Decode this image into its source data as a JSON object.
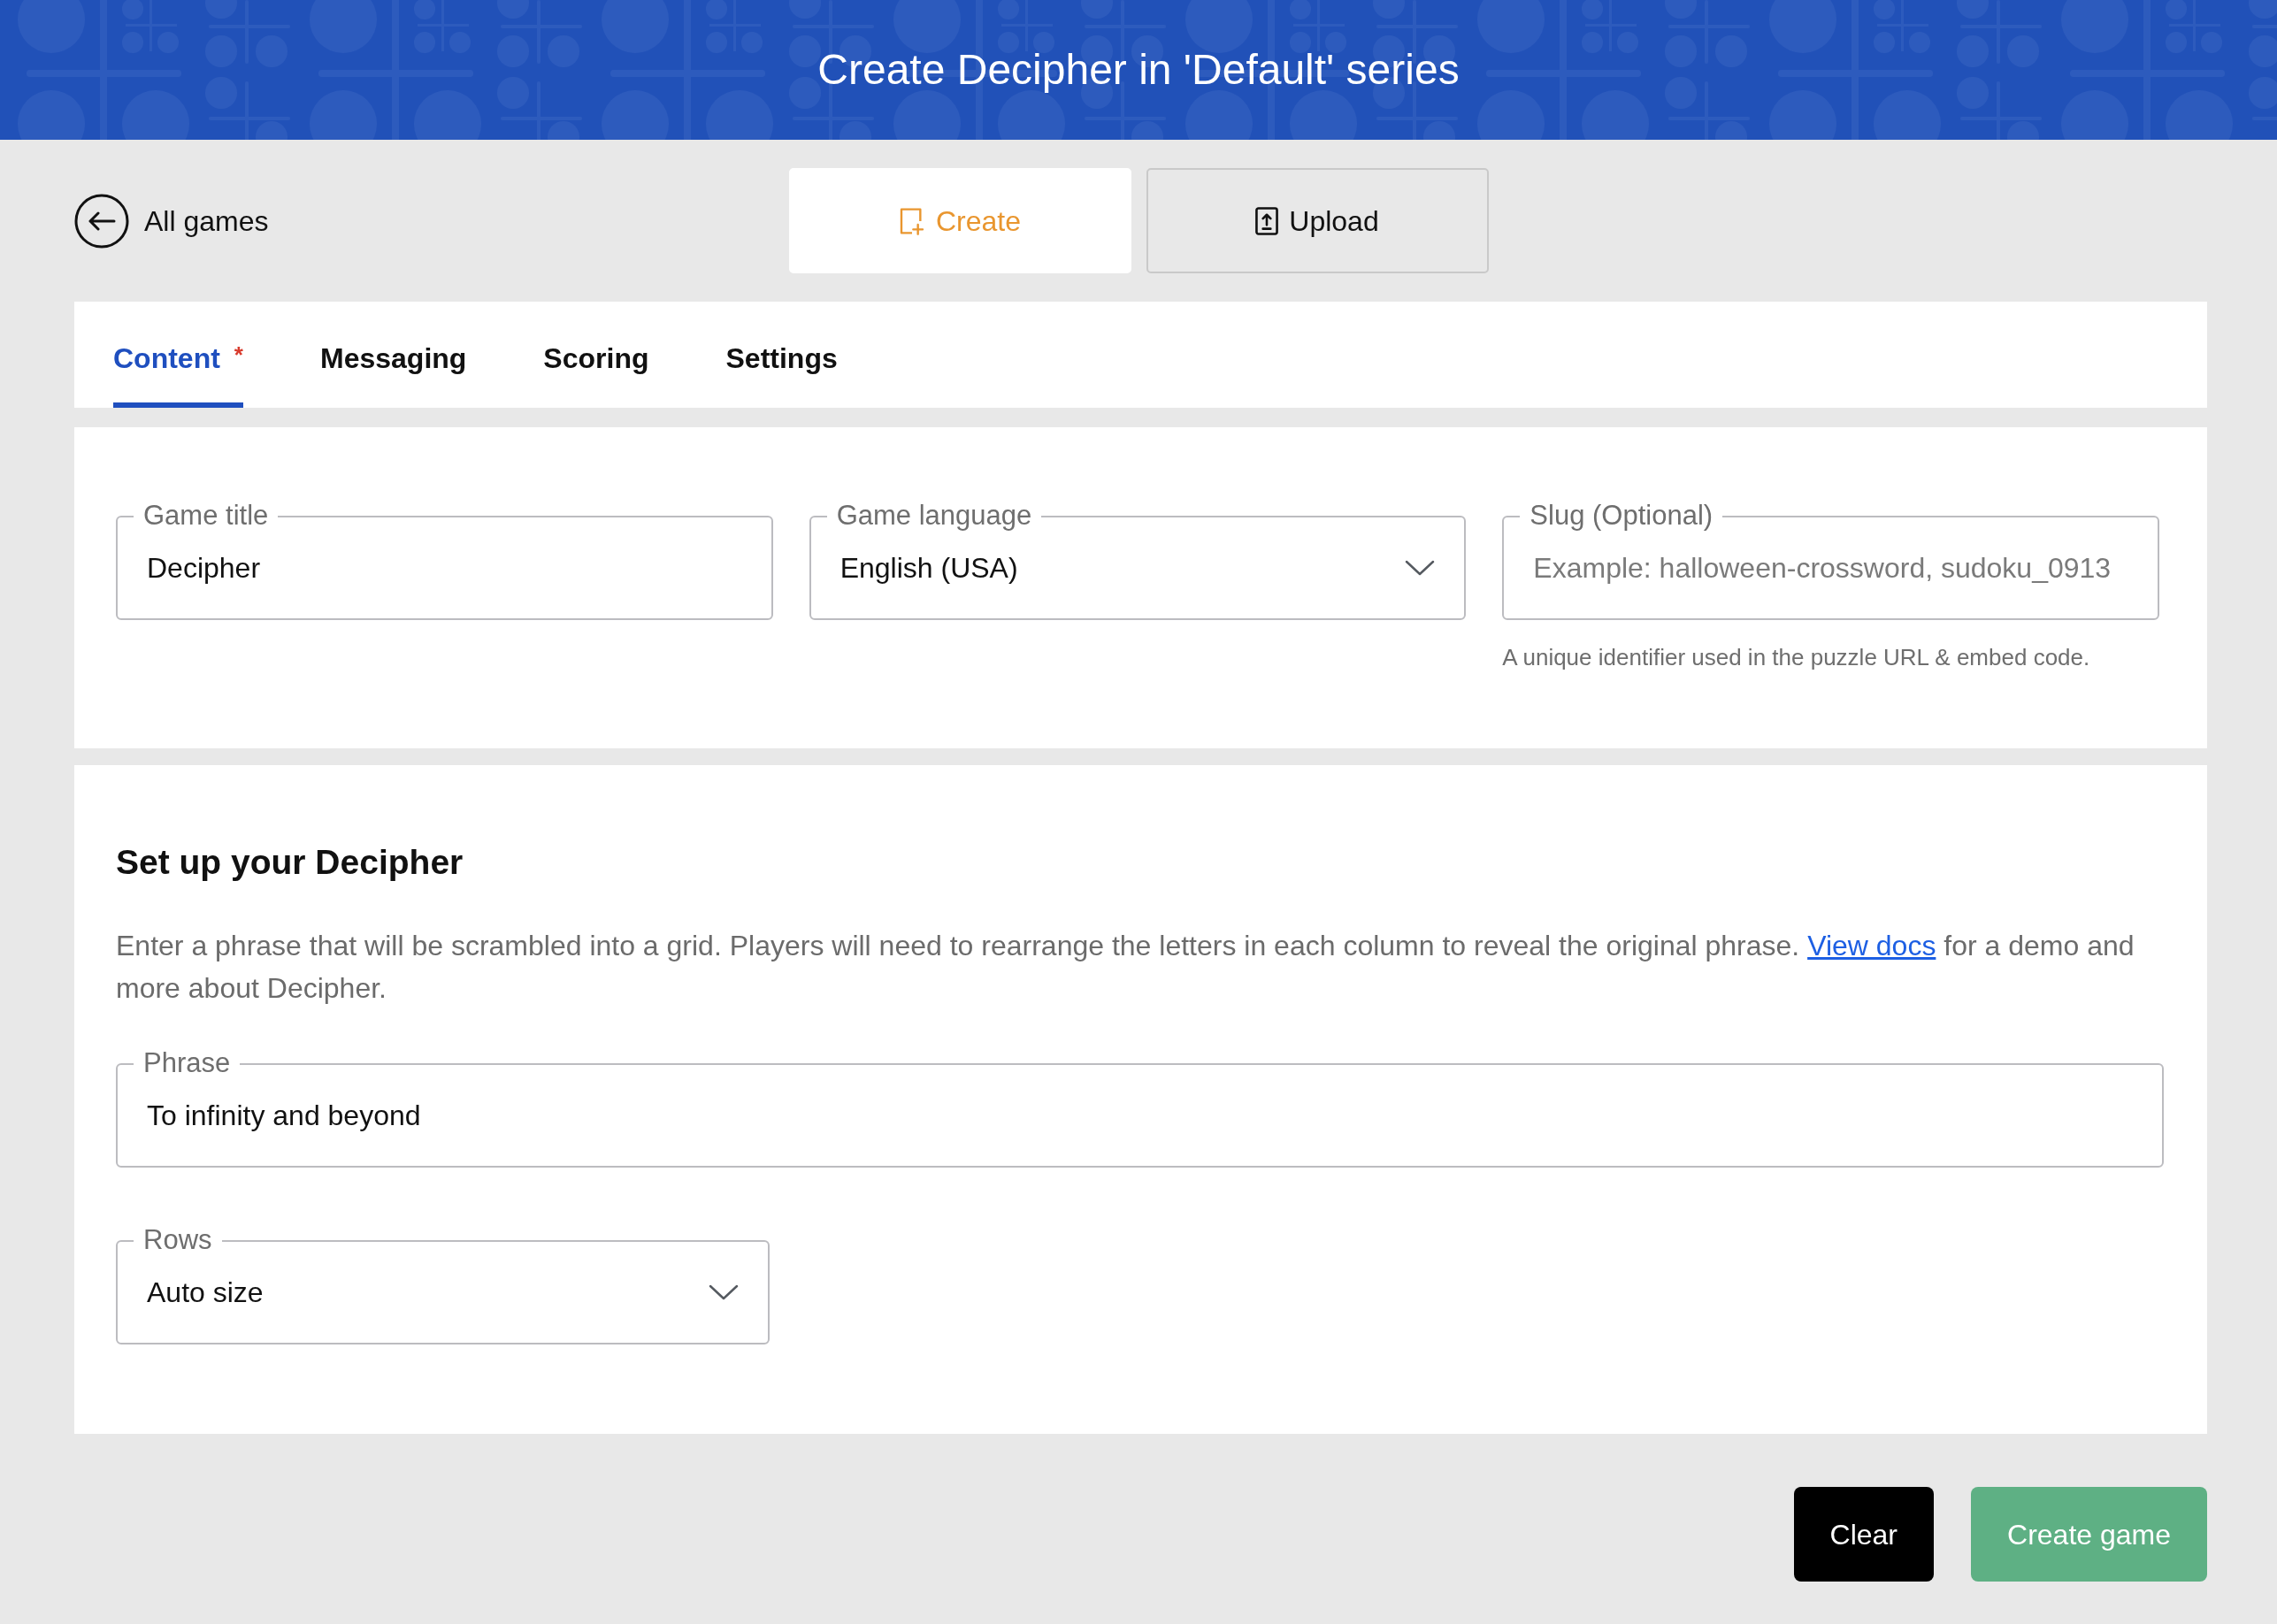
{
  "header": {
    "title": "Create Decipher in 'Default' series"
  },
  "back_link": {
    "label": "All games"
  },
  "mode_tabs": [
    {
      "label": "Create",
      "selected": true
    },
    {
      "label": "Upload",
      "selected": false
    }
  ],
  "tabs": [
    {
      "label": "Content",
      "required_mark": "*",
      "selected": true
    },
    {
      "label": "Messaging",
      "selected": false
    },
    {
      "label": "Scoring",
      "selected": false
    },
    {
      "label": "Settings",
      "selected": false
    }
  ],
  "general_fields": [
    {
      "kind": "text",
      "label": "Game title",
      "value": "Decipher"
    },
    {
      "kind": "select",
      "label": "Game language",
      "value": "English (USA)"
    },
    {
      "kind": "text",
      "label": "Slug (Optional)",
      "placeholder": "Example: halloween-crossword, sudoku_0913",
      "hint": "A unique identifier used in the puzzle URL & embed code."
    }
  ],
  "setup": {
    "title": "Set up your Decipher",
    "description_before": "Enter a phrase that will be scrambled into a grid. Players will need to rearrange the letters in each column to reveal the original phrase.",
    "link": "View docs",
    "description_after": "for a demo and more about Decipher.",
    "fields": [
      {
        "kind": "text",
        "label": "Phrase",
        "value": "To infinity and beyond"
      },
      {
        "kind": "select",
        "label": "Rows",
        "value": "Auto size"
      }
    ]
  },
  "actions": [
    {
      "kind": "secondary",
      "label": "Clear"
    },
    {
      "kind": "primary",
      "label": "Create game"
    }
  ]
}
